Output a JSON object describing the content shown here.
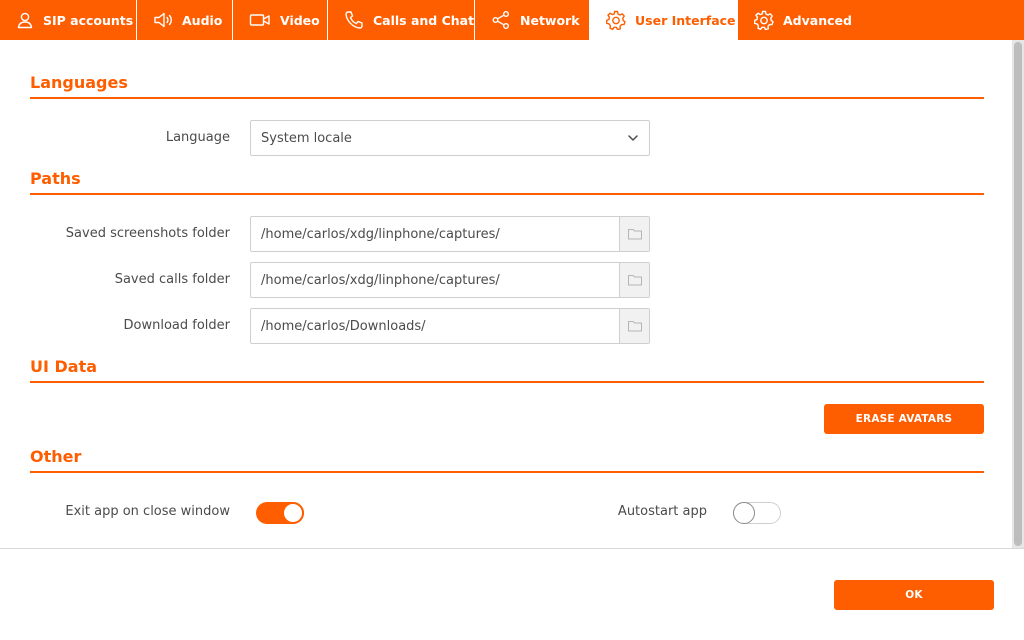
{
  "tabs": [
    {
      "label": "SIP accounts",
      "icon": "user-icon"
    },
    {
      "label": "Audio",
      "icon": "speaker-icon"
    },
    {
      "label": "Video",
      "icon": "camera-icon"
    },
    {
      "label": "Calls and Chat",
      "icon": "phone-icon"
    },
    {
      "label": "Network",
      "icon": "share-icon"
    },
    {
      "label": "User Interface",
      "icon": "gear-icon",
      "active": true
    },
    {
      "label": "Advanced",
      "icon": "gear-icon"
    }
  ],
  "languages": {
    "title": "Languages",
    "language_label": "Language",
    "language_value": "System locale"
  },
  "paths": {
    "title": "Paths",
    "screenshots_label": "Saved screenshots folder",
    "screenshots_value": "/home/carlos/xdg/linphone/captures/",
    "calls_label": "Saved calls folder",
    "calls_value": "/home/carlos/xdg/linphone/captures/",
    "download_label": "Download folder",
    "download_value": "/home/carlos/Downloads/"
  },
  "ui_data": {
    "title": "UI Data",
    "erase_avatars_label": "ERASE AVATARS"
  },
  "other": {
    "title": "Other",
    "exit_app_label": "Exit app on close window",
    "exit_app_on": true,
    "autostart_label": "Autostart app",
    "autostart_on": false
  },
  "footer": {
    "ok_label": "OK"
  },
  "colors": {
    "accent": "#fe5e00",
    "text": "#4b4b4b"
  }
}
